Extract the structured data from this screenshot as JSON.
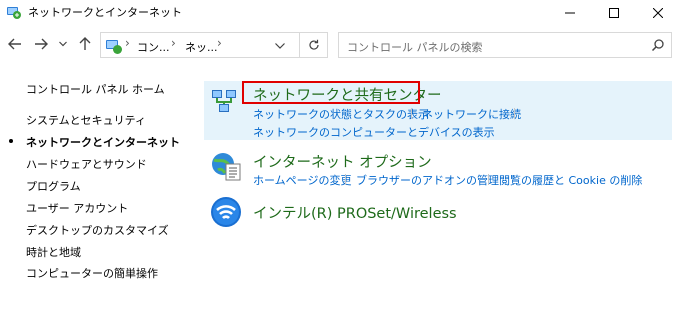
{
  "window": {
    "title": "ネットワークとインターネット"
  },
  "navigation": {
    "breadcrumb": [
      "コン...",
      "ネッ..."
    ],
    "search_placeholder": "コントロール パネルの検索"
  },
  "left_nav": {
    "home": "コントロール パネル ホーム",
    "items": [
      {
        "label": "システムとセキュリティ",
        "current": false
      },
      {
        "label": "ネットワークとインターネット",
        "current": true
      },
      {
        "label": "ハードウェアとサウンド",
        "current": false
      },
      {
        "label": "プログラム",
        "current": false
      },
      {
        "label": "ユーザー アカウント",
        "current": false
      },
      {
        "label": "デスクトップのカスタマイズ",
        "current": false
      },
      {
        "label": "時計と地域",
        "current": false
      },
      {
        "label": "コンピューターの簡単操作",
        "current": false
      }
    ]
  },
  "categories": [
    {
      "title": "ネットワークと共有センター",
      "icon": "network-sharing-icon",
      "links": [
        "ネットワークの状態とタスクの表示",
        "ネットワークに接続",
        "ネットワークのコンピューターとデバイスの表示"
      ]
    },
    {
      "title": "インターネット オプション",
      "icon": "internet-options-icon",
      "links": [
        "ホームページの変更",
        "ブラウザーのアドオンの管理",
        "閲覧の履歴と Cookie の削除"
      ]
    },
    {
      "title": "インテル(R) PROSet/Wireless",
      "icon": "wireless-icon",
      "links": []
    }
  ],
  "colors": {
    "category_title": "#1e6a1a",
    "link": "#0066cc",
    "highlight": "#e5f3fb",
    "annotation_frame": "#e00000"
  }
}
